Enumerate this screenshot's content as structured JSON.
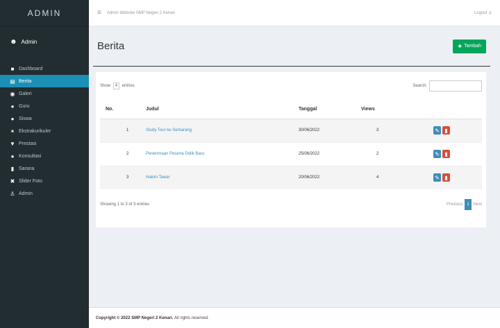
{
  "brand": "ADMIN",
  "user": {
    "name": "Admin"
  },
  "menu": [
    {
      "label": "Dashboard",
      "icon": "dashboard-icon",
      "active": false
    },
    {
      "label": "Berita",
      "icon": "newspaper-icon",
      "active": true
    },
    {
      "label": "Galeri",
      "icon": "camera-icon",
      "active": false
    },
    {
      "label": "Guru",
      "icon": "user-icon",
      "active": false
    },
    {
      "label": "Siswa",
      "icon": "users-icon",
      "active": false
    },
    {
      "label": "Ekstrakurikuler",
      "icon": "star-icon",
      "active": false
    },
    {
      "label": "Prestasi",
      "icon": "trophy-icon",
      "active": false
    },
    {
      "label": "Konsultasi",
      "icon": "chat-icon",
      "active": false
    },
    {
      "label": "Sarana",
      "icon": "building-icon",
      "active": false
    },
    {
      "label": "Slider Foto",
      "icon": "image-icon",
      "active": false
    },
    {
      "label": "Admin",
      "icon": "admin-icon",
      "active": false
    }
  ],
  "topbar": {
    "crumb": "Admin Website SMP Negeri 2 Kenari",
    "logout": "Logout"
  },
  "page": {
    "title": "Berita",
    "add_label": "Tambah"
  },
  "controls": {
    "show": "Show",
    "entries_value": "4",
    "entries": "entries",
    "search": "Search:"
  },
  "table": {
    "headers": [
      "No.",
      "Judul",
      "Tanggal",
      "Views",
      ""
    ],
    "rows": [
      {
        "no": "1",
        "judul": "Study Tour ke Semarang",
        "tanggal": "30/06/2022",
        "views": "3"
      },
      {
        "no": "2",
        "judul": "Penerimaan Peserta Didik Baru",
        "tanggal": "25/06/2022",
        "views": "2"
      },
      {
        "no": "3",
        "judul": "Hakim Tawar",
        "tanggal": "20/06/2022",
        "views": "4"
      }
    ]
  },
  "info": "Showing 1 to 3 of 3 entries",
  "pagination": {
    "prev": "Previous",
    "current": "1",
    "next": "Next"
  },
  "footer": {
    "copyright": "Copyright © 2022 SMP Negeri 2 Kenari.",
    "rights": "All rights reserved."
  }
}
